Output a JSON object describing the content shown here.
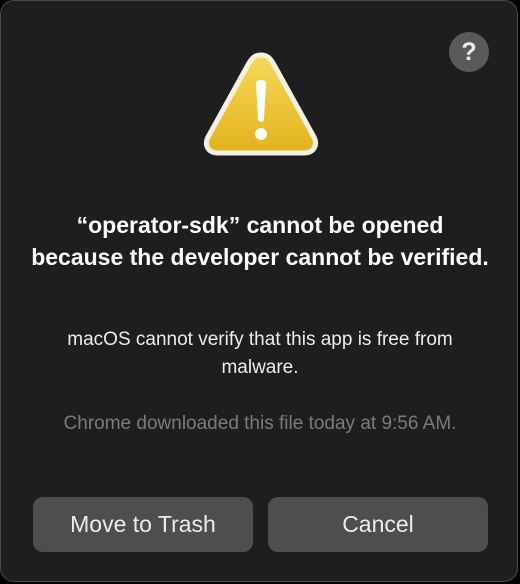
{
  "dialog": {
    "help_label": "?",
    "icon": "warning-triangle-icon",
    "title": "“operator-sdk” cannot be opened because the developer cannot be verified.",
    "message": "macOS cannot verify that this app is free from malware.",
    "info": "Chrome downloaded this file today at 9:56 AM.",
    "buttons": {
      "move_to_trash": "Move to Trash",
      "cancel": "Cancel"
    }
  },
  "colors": {
    "background": "#1e1e1f",
    "warning_yellow": "#f0c53a",
    "button": "#4e4e50",
    "secondary_text": "#7b7b7d"
  }
}
